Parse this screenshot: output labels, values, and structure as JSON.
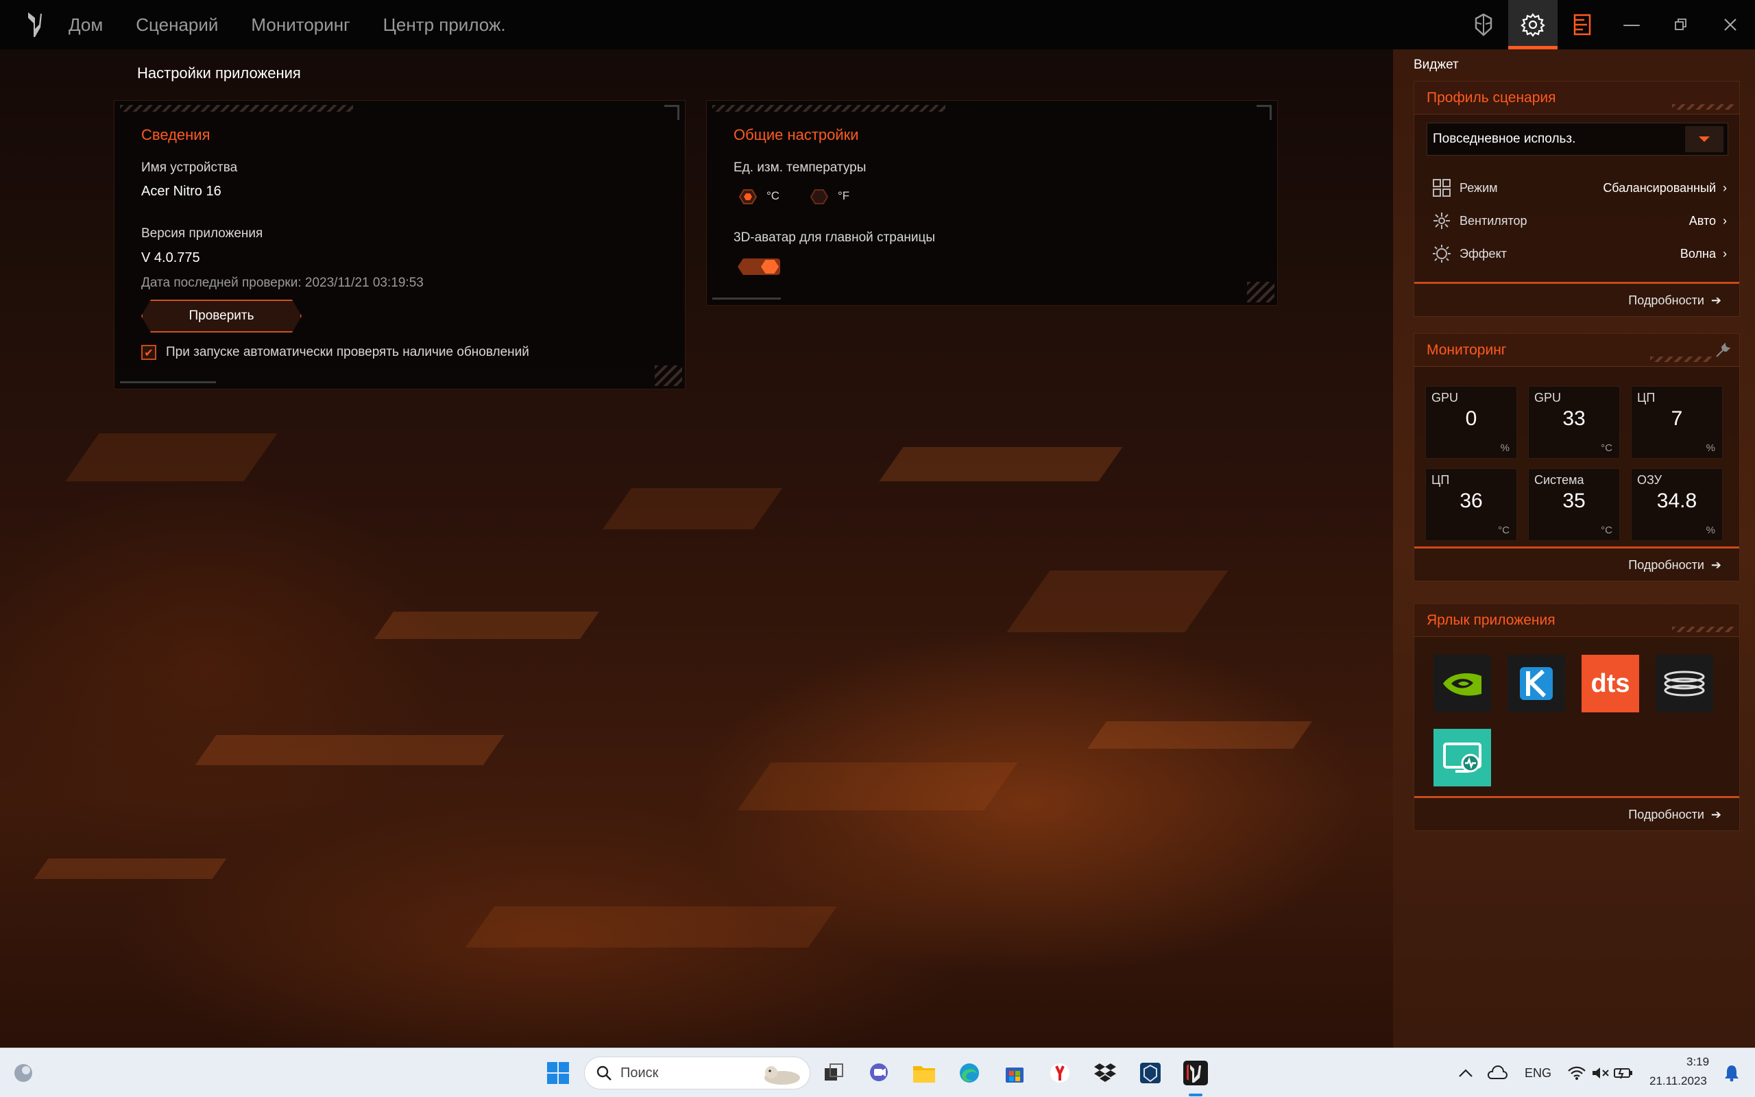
{
  "nav": {
    "items": [
      "Дом",
      "Сценарий",
      "Мониторинг",
      "Центр прилож."
    ]
  },
  "page": {
    "title": "Настройки приложения"
  },
  "info_panel": {
    "title": "Сведения",
    "device_label": "Имя устройства",
    "device_value": "Acer Nitro 16",
    "version_label": "Версия приложения",
    "version_value": "V 4.0.775",
    "last_check": "Дата последней проверки: 2023/11/21 03:19:53",
    "check_button": "Проверить",
    "auto_update_label": "При запуске автоматически проверять наличие обновлений",
    "auto_update_checked": true
  },
  "general_panel": {
    "title": "Общие настройки",
    "temp_label": "Ед. изм. температуры",
    "temp_c": "°C",
    "temp_f": "°F",
    "temp_selected": "°C",
    "avatar_label": "3D-аватар для главной страницы",
    "avatar_enabled": true
  },
  "sidebar": {
    "title": "Виджет",
    "profile": {
      "title": "Профиль сценария",
      "selected": "Повседневное использ.",
      "rows": [
        {
          "label": "Режим",
          "value": "Сбалансированный",
          "icon": "grid-icon"
        },
        {
          "label": "Вентилятор",
          "value": "Авто",
          "icon": "fan-icon"
        },
        {
          "label": "Эффект",
          "value": "Волна",
          "icon": "sun-icon"
        }
      ],
      "more": "Подробности"
    },
    "monitoring": {
      "title": "Мониторинг",
      "tiles": [
        {
          "name": "GPU",
          "value": "0",
          "unit": "%"
        },
        {
          "name": "GPU",
          "value": "33",
          "unit": "°C"
        },
        {
          "name": "ЦП",
          "value": "7",
          "unit": "%"
        },
        {
          "name": "ЦП",
          "value": "36",
          "unit": "°C"
        },
        {
          "name": "Система",
          "value": "35",
          "unit": "°C"
        },
        {
          "name": "ОЗУ",
          "value": "34.8",
          "unit": "%"
        }
      ],
      "more": "Подробности"
    },
    "shortcuts": {
      "title": "Ярлык приложения",
      "apps": [
        {
          "name": "nvidia-icon",
          "color": "#76b900"
        },
        {
          "name": "k-app-icon",
          "color": "#1e8fd8"
        },
        {
          "name": "dts-icon",
          "color": "#f0532a",
          "text": "dts"
        },
        {
          "name": "coil-app-icon",
          "color": "#d8d8d8"
        },
        {
          "name": "screen-monitor-app-icon",
          "color": "#2bbfa5"
        }
      ],
      "more": "Подробности"
    }
  },
  "taskbar": {
    "search_placeholder": "Поиск",
    "lang": "ENG",
    "time": "3:19",
    "date": "21.11.2023"
  },
  "colors": {
    "accent": "#ff5a1f",
    "sidebar_bg": "#3a1a0c"
  }
}
